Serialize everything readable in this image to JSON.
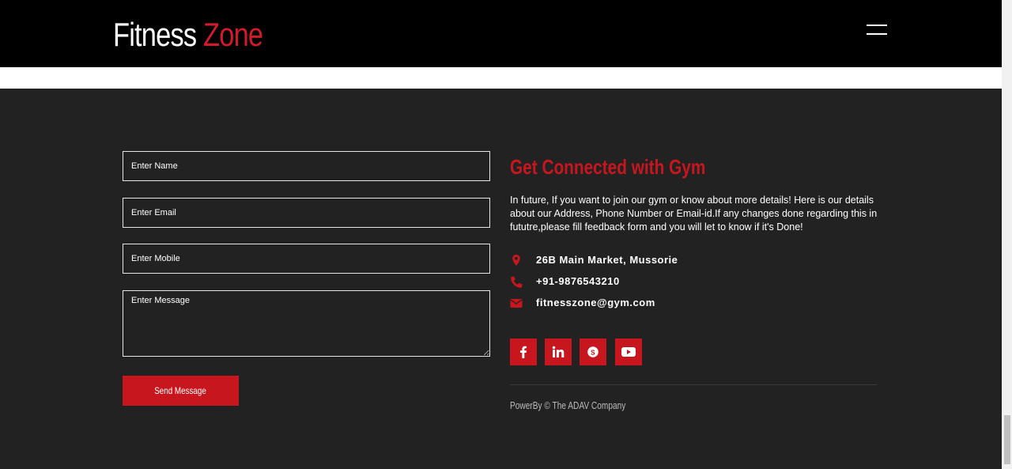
{
  "brand": {
    "name_part1": "Fitness",
    "name_part2": "Zone"
  },
  "form": {
    "name_placeholder": "Enter Name",
    "email_placeholder": "Enter Email",
    "mobile_placeholder": "Enter Mobile",
    "message_placeholder": "Enter Message",
    "submit_label": "Send Message"
  },
  "connect": {
    "title": "Get Connected with Gym",
    "description": "In future, If you want to join our gym or know about more details! Here is our details about our Address, Phone Number or Email-id.If any changes done regarding this in fututre,please fill feedback form and you will let to know if it's Done!",
    "address": "26B Main Market, Mussorie",
    "phone": "+91-9876543210",
    "email": "fitnesszone@gym.com"
  },
  "social": [
    {
      "icon": "facebook-icon"
    },
    {
      "icon": "linkedin-icon"
    },
    {
      "icon": "skype-icon"
    },
    {
      "icon": "youtube-icon"
    }
  ],
  "footer": {
    "powered_by": "PowerBy © The ADAV Company"
  },
  "colors": {
    "accent": "#c8161f",
    "background": "#222222",
    "header": "#000000"
  }
}
